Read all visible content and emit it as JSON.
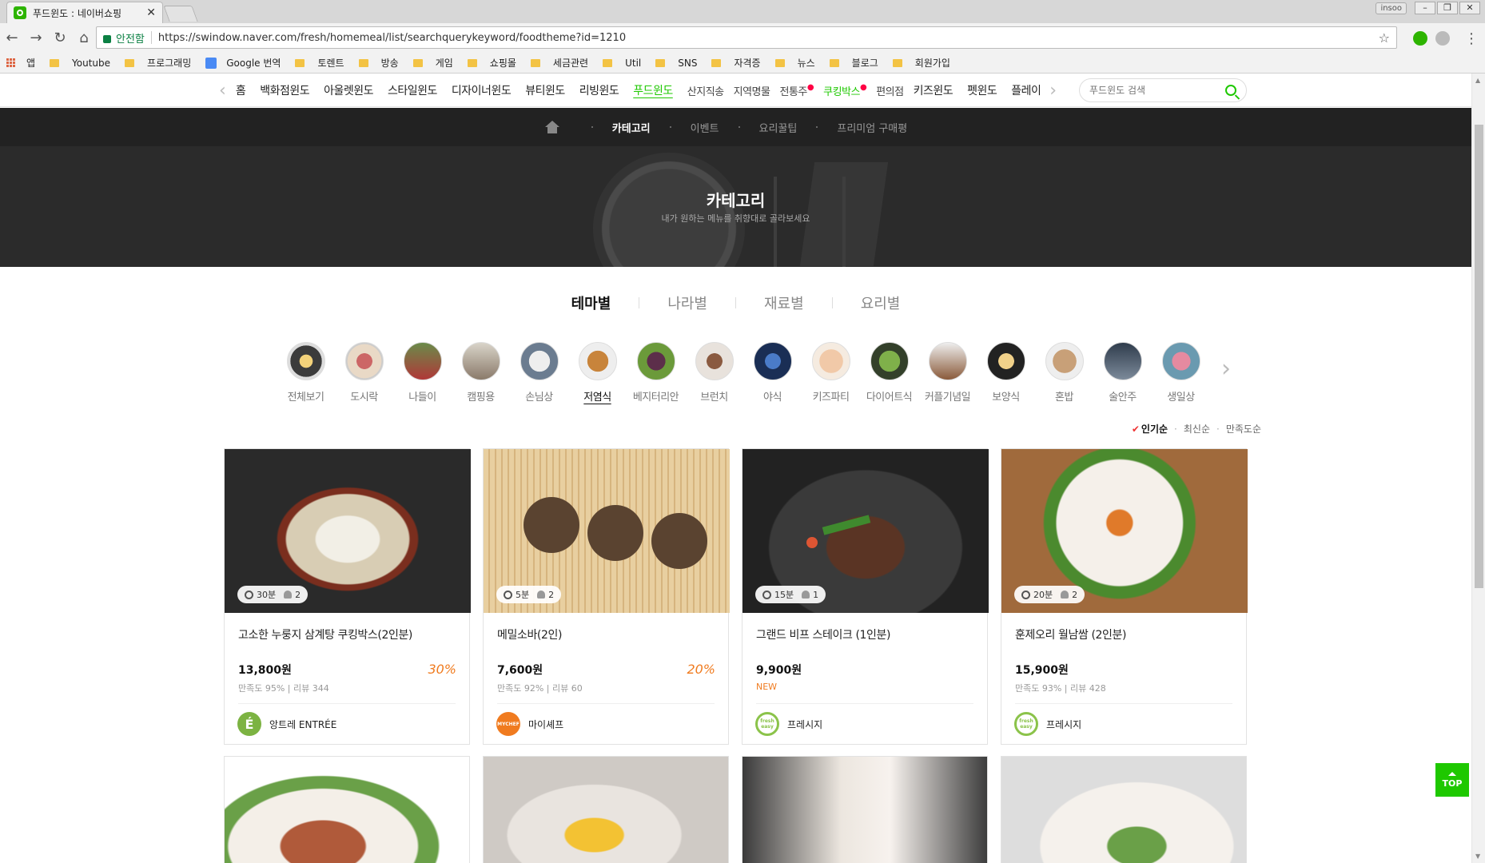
{
  "browser": {
    "tab_title": "푸드윈도 : 네이버쇼핑",
    "secure_label": "안전함",
    "url": "https://swindow.naver.com/fresh/homemeal/list/searchquerykeyword/foodtheme?id=1210",
    "profile": "insoo",
    "bookmarks": [
      "앱",
      "Youtube",
      "프로그래밍",
      "Google 번역",
      "토렌트",
      "방송",
      "게임",
      "쇼핑몰",
      "세금관련",
      "Util",
      "SNS",
      "자격증",
      "뉴스",
      "블로그",
      "회원가입"
    ]
  },
  "gnb": {
    "items": [
      "홈",
      "백화점윈도",
      "아울렛윈도",
      "스타일윈도",
      "디자이너윈도",
      "뷰티윈도",
      "리빙윈도",
      "푸드윈도",
      "산지직송",
      "지역명물",
      "전통주",
      "쿠킹박스",
      "편의점",
      "키즈윈도",
      "펫윈도",
      "플레이"
    ],
    "search_placeholder": "푸드윈도 검색"
  },
  "subnav": [
    "카테고리",
    "이벤트",
    "요리꿀팁",
    "프리미엄 구매평"
  ],
  "hero": {
    "title": "카테고리",
    "subtitle": "내가 원하는 메뉴를 취향대로 골라보세요"
  },
  "tabs": [
    "테마별",
    "나라별",
    "재료별",
    "요리별"
  ],
  "themes": [
    "전체보기",
    "도시락",
    "나들이",
    "캠핑용",
    "손님상",
    "저염식",
    "베지터리안",
    "브런치",
    "야식",
    "키즈파티",
    "다이어트식",
    "커플기념일",
    "보양식",
    "혼밥",
    "술안주",
    "생일상"
  ],
  "sort": [
    "인기순",
    "최신순",
    "만족도순"
  ],
  "products": [
    {
      "time": "30분",
      "people": "2",
      "name": "고소한 누룽지 삼계탕 쿠킹박스(2인분)",
      "price": "13,800원",
      "discount": "30%",
      "satisfaction": "만족도 95%",
      "reviews": "리뷰 344",
      "seller": "앙트레 ENTRÉE",
      "logo": "É",
      "logo_color": "#7cb342"
    },
    {
      "time": "5분",
      "people": "2",
      "name": "메밀소바(2인)",
      "price": "7,600원",
      "discount": "20%",
      "satisfaction": "만족도 92%",
      "reviews": "리뷰 60",
      "seller": "마이셰프",
      "logo": "MYCHEF",
      "logo_color": "#f07b1f"
    },
    {
      "time": "15분",
      "people": "1",
      "name": "그랜드 비프 스테이크 (1인분)",
      "price": "9,900원",
      "badge": "NEW",
      "seller": "프레시지",
      "logo": "fresh easy",
      "logo_color": "#8bc34a"
    },
    {
      "time": "20분",
      "people": "2",
      "name": "훈제오리 월남쌈 (2인분)",
      "price": "15,900원",
      "satisfaction": "만족도 93%",
      "reviews": "리뷰 428",
      "seller": "프레시지",
      "logo": "fresh easy",
      "logo_color": "#8bc34a"
    }
  ],
  "top_button": "TOP"
}
